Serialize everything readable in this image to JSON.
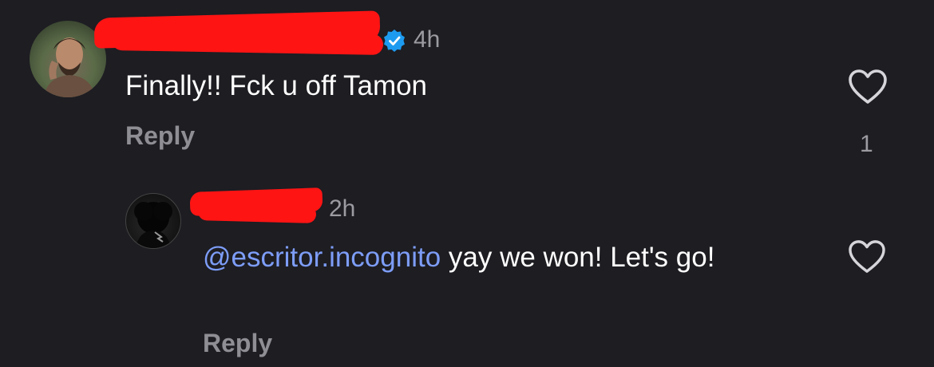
{
  "comments": [
    {
      "time": "4h",
      "verified": true,
      "text": "Finally!! Fck u off Tamon",
      "reply_label": "Reply",
      "like_count": "1",
      "icons": {
        "avatar": "avatar",
        "verified": "verified-badge-icon",
        "like": "heart-icon"
      }
    },
    {
      "time": "2h",
      "mention": "@escritor.incognito",
      "text": " yay we won! Let's go!",
      "reply_label": "Reply",
      "icons": {
        "avatar": "avatar",
        "like": "heart-icon"
      }
    }
  ],
  "colors": {
    "background": "#1d1d22",
    "mention": "#7d9df8",
    "verified": "#1d9bf0",
    "redaction": "#ff1414",
    "muted": "#8e8e94"
  }
}
